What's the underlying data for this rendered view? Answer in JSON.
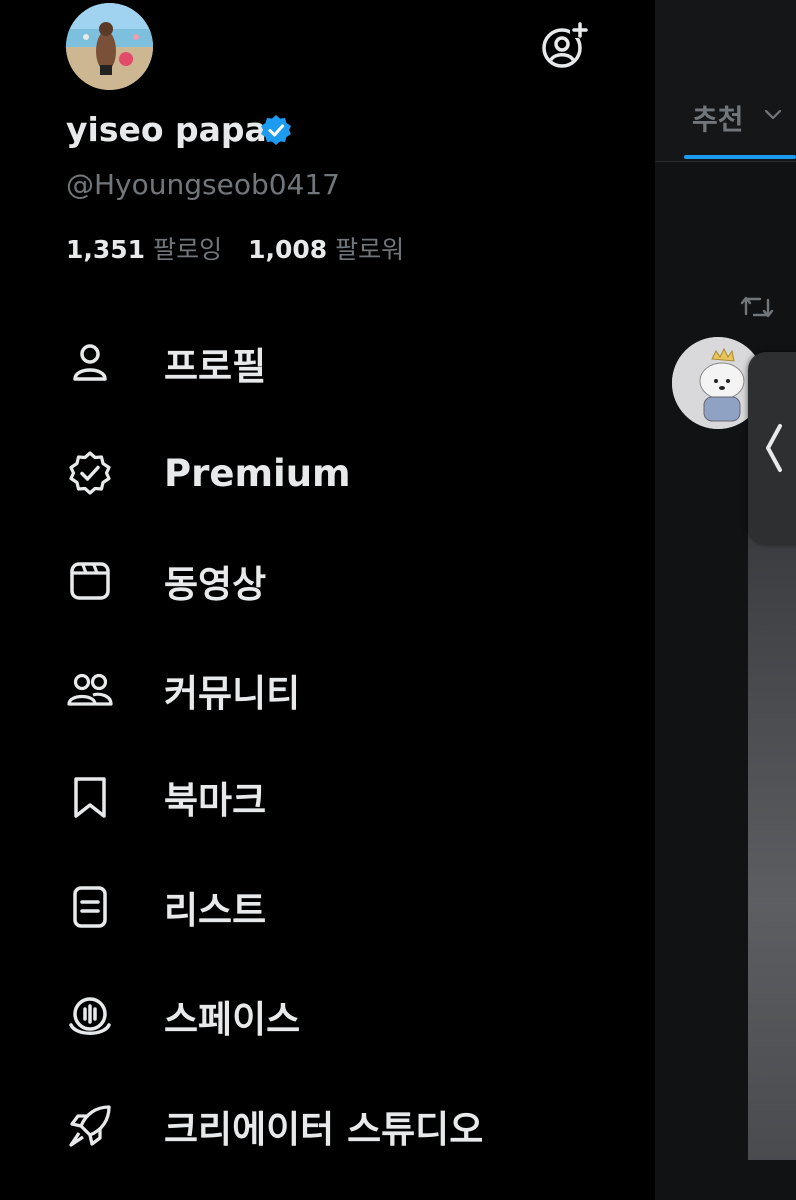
{
  "profile": {
    "display_name": "yiseo papa",
    "handle": "@Hyoungseob0417",
    "following_count": "1,351",
    "following_label": "팔로잉",
    "followers_count": "1,008",
    "followers_label": "팔로워"
  },
  "menu": [
    {
      "label": "프로필",
      "icon": "person-icon"
    },
    {
      "label": "Premium",
      "icon": "verified-badge-outline-icon"
    },
    {
      "label": "동영상",
      "icon": "video-icon"
    },
    {
      "label": "커뮤니티",
      "icon": "communities-icon"
    },
    {
      "label": "북마크",
      "icon": "bookmark-icon"
    },
    {
      "label": "리스트",
      "icon": "list-icon"
    },
    {
      "label": "스페이스",
      "icon": "spaces-icon"
    },
    {
      "label": "크리에이터 스튜디오",
      "icon": "rocket-icon"
    }
  ],
  "feed": {
    "tab_label": "추천"
  },
  "colors": {
    "background": "#000000",
    "text_primary": "#e7e9ea",
    "text_secondary": "#71767b",
    "accent": "#1d9bf0"
  }
}
